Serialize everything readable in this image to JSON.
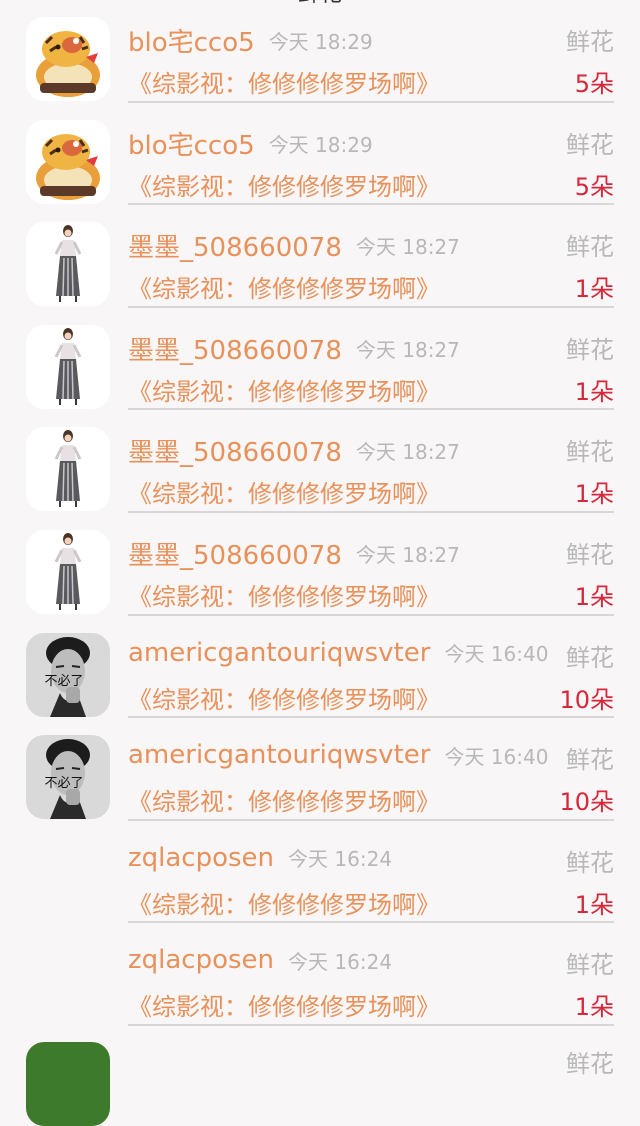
{
  "header": {
    "title": "鲜花"
  },
  "gift_records": [
    {
      "avatar": "tiger-cartoon",
      "username": "blo宅cco5",
      "time": "今天 18:29",
      "gift": "鲜花",
      "book": "《综影视：修修修修罗场啊》",
      "count": "5朵"
    },
    {
      "avatar": "tiger-cartoon",
      "username": "blo宅cco5",
      "time": "今天 18:29",
      "gift": "鲜花",
      "book": "《综影视：修修修修罗场啊》",
      "count": "5朵"
    },
    {
      "avatar": "fashion-girl",
      "username": "墨墨_508660078",
      "time": "今天 18:27",
      "gift": "鲜花",
      "book": "《综影视：修修修修罗场啊》",
      "count": "1朵"
    },
    {
      "avatar": "fashion-girl",
      "username": "墨墨_508660078",
      "time": "今天 18:27",
      "gift": "鲜花",
      "book": "《综影视：修修修修罗场啊》",
      "count": "1朵"
    },
    {
      "avatar": "fashion-girl",
      "username": "墨墨_508660078",
      "time": "今天 18:27",
      "gift": "鲜花",
      "book": "《综影视：修修修修罗场啊》",
      "count": "1朵"
    },
    {
      "avatar": "fashion-girl",
      "username": "墨墨_508660078",
      "time": "今天 18:27",
      "gift": "鲜花",
      "book": "《综影视：修修修修罗场啊》",
      "count": "1朵"
    },
    {
      "avatar": "man-bw",
      "avatar_caption": "不必了",
      "username": "americgantouriqwsvter",
      "time": "今天 16:40",
      "gift": "鲜花",
      "book": "《综影视：修修修修罗场啊》",
      "count": "10朵"
    },
    {
      "avatar": "man-bw",
      "avatar_caption": "不必了",
      "username": "americgantouriqwsvter",
      "time": "今天 16:40",
      "gift": "鲜花",
      "book": "《综影视：修修修修罗场啊》",
      "count": "10朵"
    },
    {
      "avatar": "none",
      "username": "zqlacposen",
      "time": "今天 16:24",
      "gift": "鲜花",
      "book": "《综影视：修修修修罗场啊》",
      "count": "1朵"
    },
    {
      "avatar": "none",
      "username": "zqlacposen",
      "time": "今天 16:24",
      "gift": "鲜花",
      "book": "《综影视：修修修修罗场啊》",
      "count": "1朵"
    }
  ],
  "partial_row": {
    "gift": "鲜花"
  }
}
